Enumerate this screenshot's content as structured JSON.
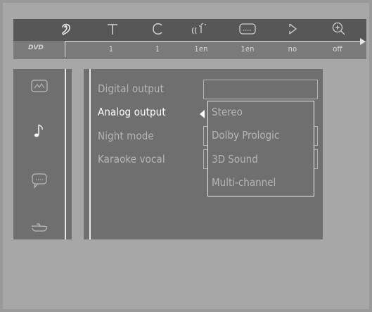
{
  "topbar": {
    "icons": [
      "setup-icon",
      "title-icon",
      "chapter-icon",
      "audio-icon",
      "subtitle-icon",
      "angle-icon",
      "zoom-icon"
    ]
  },
  "infobar": {
    "logo_text": "DVD",
    "values": [
      "1",
      "1",
      "1en",
      "1en",
      "no",
      "off"
    ]
  },
  "leftpanel": {
    "icons": [
      "picture-icon",
      "music-note-icon",
      "speech-bubble-icon",
      "pointing-hand-icon"
    ]
  },
  "menu": {
    "items": [
      "Digital output",
      "Analog output",
      "Night mode",
      "Karaoke vocal"
    ],
    "active_index": 1
  },
  "dropdown": {
    "options": [
      "Stereo",
      "Dolby Prologic",
      "3D Sound",
      "Multi-channel"
    ]
  }
}
